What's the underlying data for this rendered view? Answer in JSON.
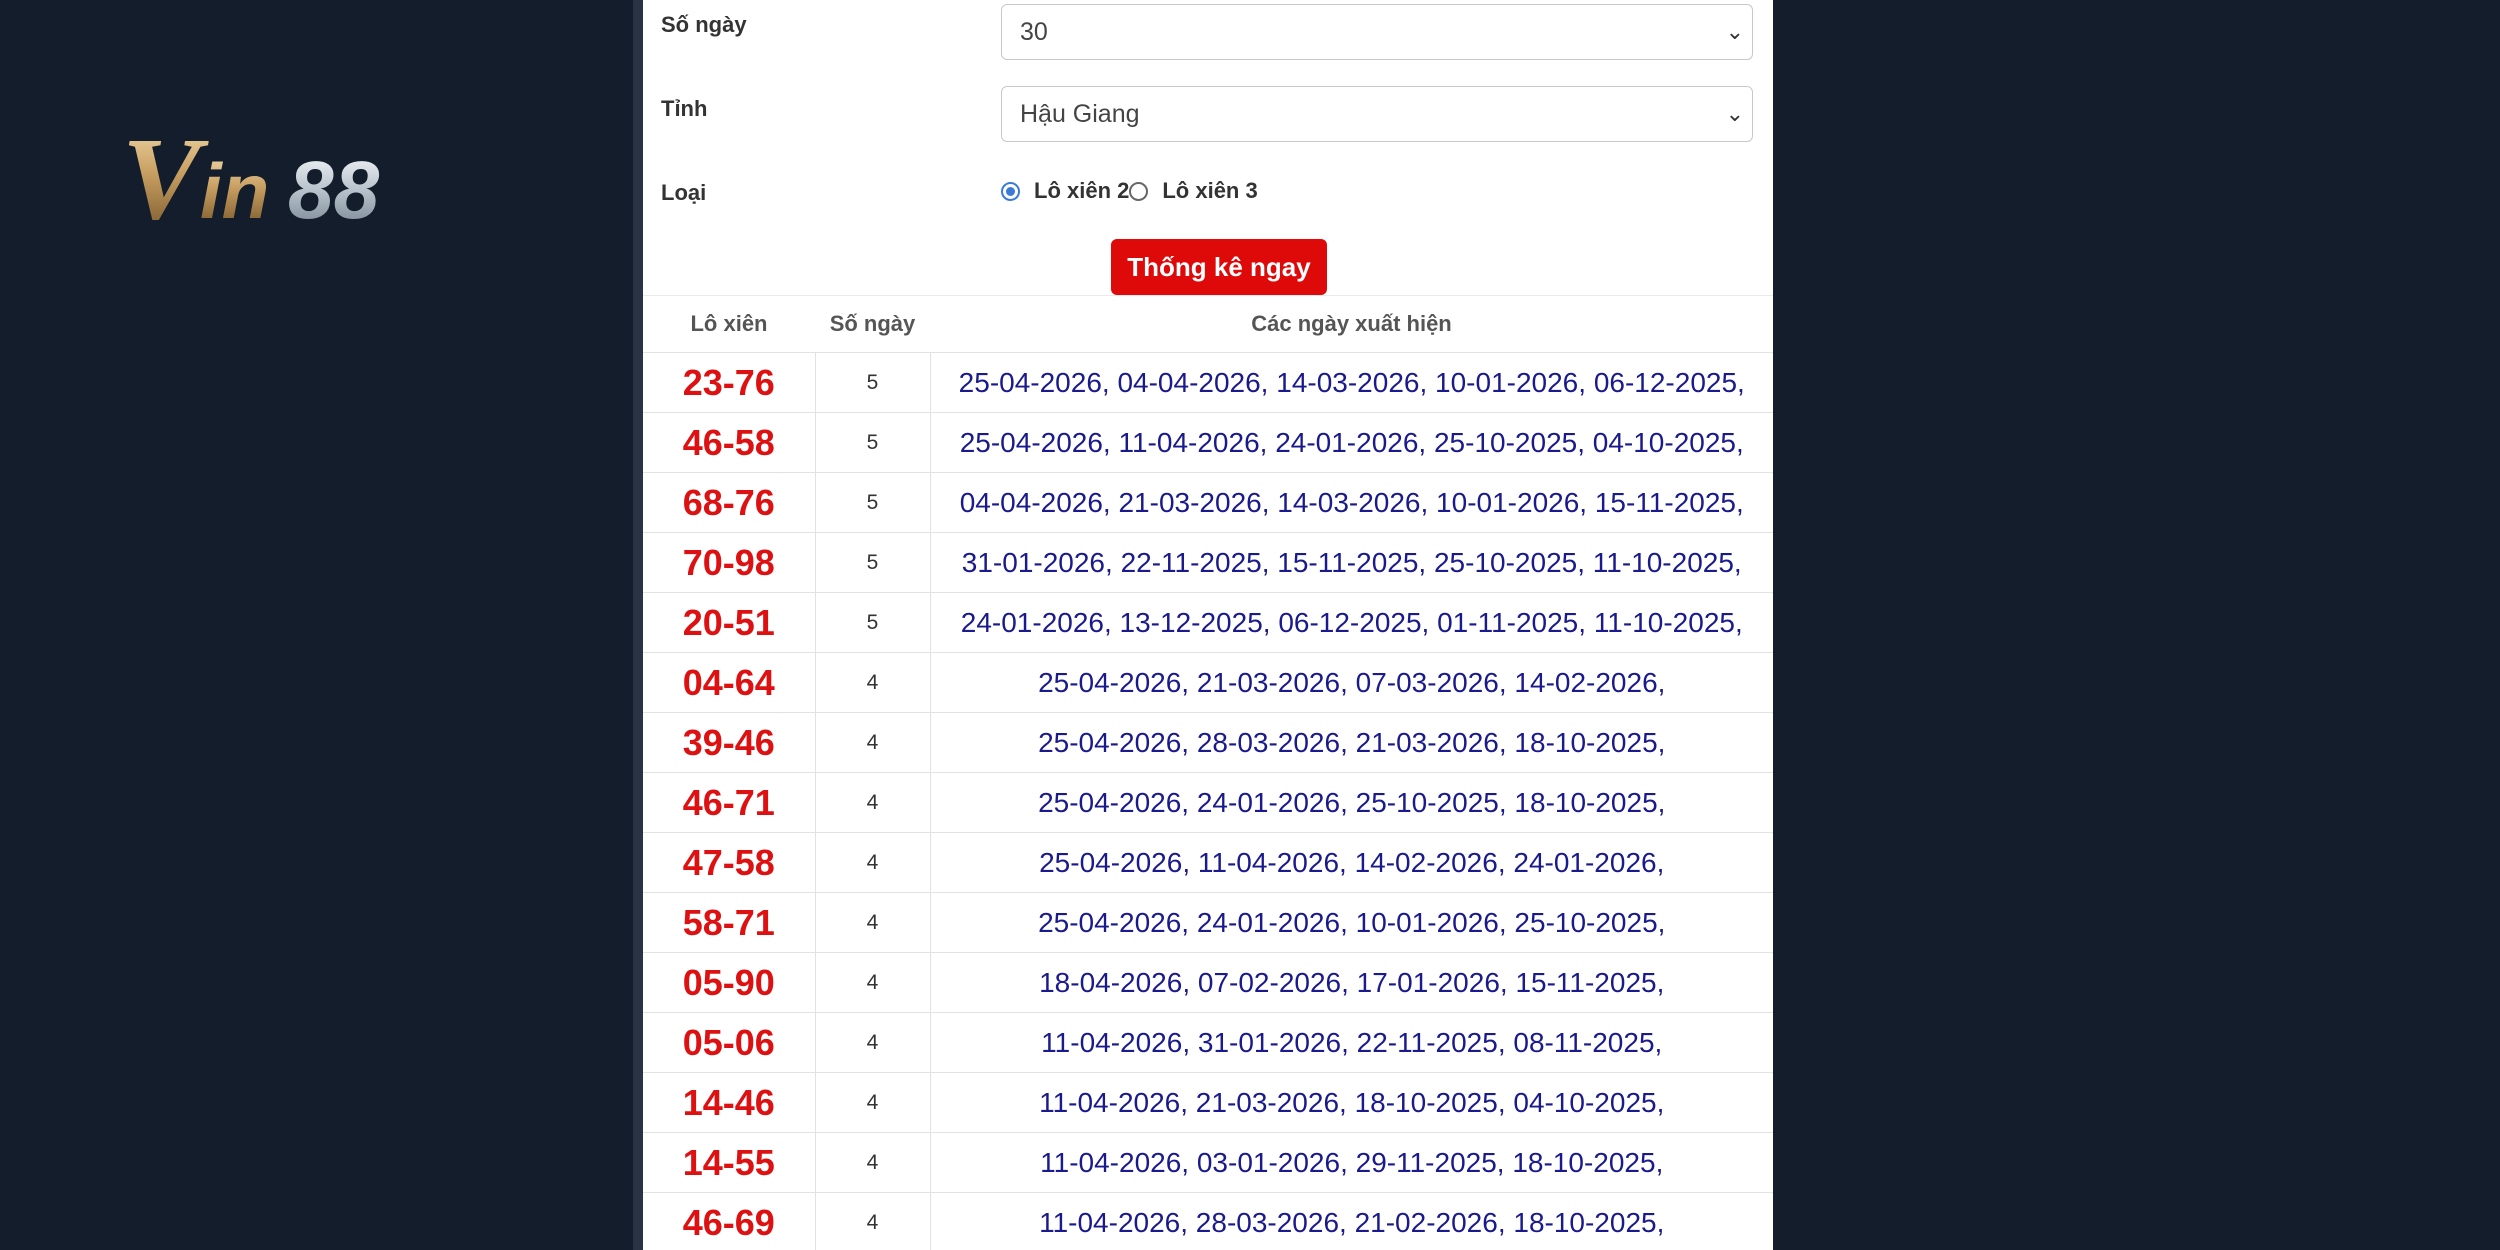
{
  "brand": {
    "logo_text": "Vin88"
  },
  "form": {
    "days": {
      "label": "Số ngày",
      "value": "30"
    },
    "province": {
      "label": "Tỉnh",
      "value": "Hậu Giang"
    },
    "type": {
      "label": "Loại",
      "options": [
        {
          "label": "Lô xiên 2",
          "selected": true
        },
        {
          "label": "Lô xiên 3",
          "selected": false
        }
      ]
    },
    "submit_label": "Thống kê ngay"
  },
  "table": {
    "headers": [
      "Lô xiên",
      "Số ngày",
      "Các ngày xuất hiện"
    ],
    "rows": [
      {
        "pair": "23-76",
        "count": "5",
        "dates": "25-04-2026, 04-04-2026, 14-03-2026, 10-01-2026, 06-12-2025,"
      },
      {
        "pair": "46-58",
        "count": "5",
        "dates": "25-04-2026, 11-04-2026, 24-01-2026, 25-10-2025, 04-10-2025,"
      },
      {
        "pair": "68-76",
        "count": "5",
        "dates": "04-04-2026, 21-03-2026, 14-03-2026, 10-01-2026, 15-11-2025,"
      },
      {
        "pair": "70-98",
        "count": "5",
        "dates": "31-01-2026, 22-11-2025, 15-11-2025, 25-10-2025, 11-10-2025,"
      },
      {
        "pair": "20-51",
        "count": "5",
        "dates": "24-01-2026, 13-12-2025, 06-12-2025, 01-11-2025, 11-10-2025,"
      },
      {
        "pair": "04-64",
        "count": "4",
        "dates": "25-04-2026, 21-03-2026, 07-03-2026, 14-02-2026,"
      },
      {
        "pair": "39-46",
        "count": "4",
        "dates": "25-04-2026, 28-03-2026, 21-03-2026, 18-10-2025,"
      },
      {
        "pair": "46-71",
        "count": "4",
        "dates": "25-04-2026, 24-01-2026, 25-10-2025, 18-10-2025,"
      },
      {
        "pair": "47-58",
        "count": "4",
        "dates": "25-04-2026, 11-04-2026, 14-02-2026, 24-01-2026,"
      },
      {
        "pair": "58-71",
        "count": "4",
        "dates": "25-04-2026, 24-01-2026, 10-01-2026, 25-10-2025,"
      },
      {
        "pair": "05-90",
        "count": "4",
        "dates": "18-04-2026, 07-02-2026, 17-01-2026, 15-11-2025,"
      },
      {
        "pair": "05-06",
        "count": "4",
        "dates": "11-04-2026, 31-01-2026, 22-11-2025, 08-11-2025,"
      },
      {
        "pair": "14-46",
        "count": "4",
        "dates": "11-04-2026, 21-03-2026, 18-10-2025, 04-10-2025,"
      },
      {
        "pair": "14-55",
        "count": "4",
        "dates": "11-04-2026, 03-01-2026, 29-11-2025, 18-10-2025,"
      },
      {
        "pair": "46-69",
        "count": "4",
        "dates": "11-04-2026, 28-03-2026, 21-02-2026, 18-10-2025,"
      }
    ]
  },
  "colors": {
    "background": "#141d2c",
    "pair_red": "#dd1111",
    "date_blue": "#1a1a8c",
    "button_red": "#de0a0a"
  }
}
